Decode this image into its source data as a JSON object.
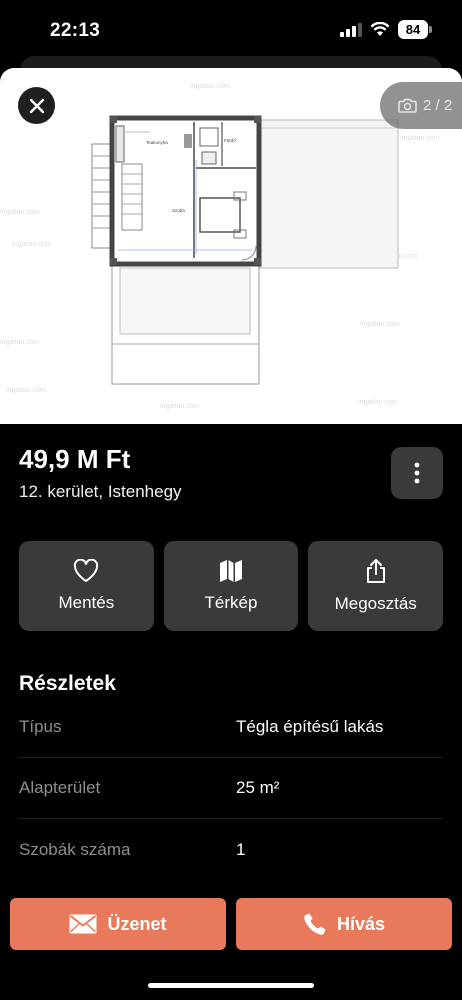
{
  "status_bar": {
    "time": "22:13",
    "battery": "84",
    "icons": [
      "signal-icon",
      "wifi-icon",
      "battery-icon"
    ]
  },
  "gallery": {
    "counter": "2 / 2",
    "watermark": "ingatlan.com",
    "plan_labels": [
      "Teakonyha",
      "Fürdő",
      "Szoba"
    ]
  },
  "listing": {
    "price": "49,9 M Ft",
    "location": "12. kerület, Istenhegy"
  },
  "actions": [
    {
      "label": "Mentés",
      "icon": "heart-icon"
    },
    {
      "label": "Térkép",
      "icon": "map-icon"
    },
    {
      "label": "Megosztás",
      "icon": "share-icon"
    }
  ],
  "details": {
    "title": "Részletek",
    "rows": [
      {
        "key": "Típus",
        "value": "Tégla építésű lakás"
      },
      {
        "key": "Alapterület",
        "value": "25 m²"
      },
      {
        "key": "Szobák száma",
        "value": "1"
      }
    ]
  },
  "bottom": {
    "message_label": "Üzenet",
    "call_label": "Hívás"
  },
  "colors": {
    "accent": "#e8795a",
    "card": "#3a3a3c",
    "muted_text": "#8e8e93"
  }
}
